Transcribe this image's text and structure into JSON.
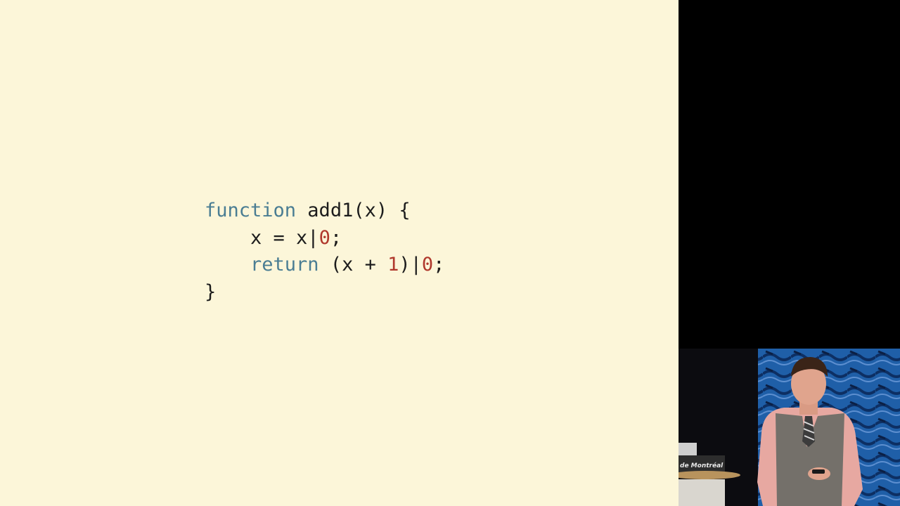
{
  "slide": {
    "background": "#fcf6d9",
    "code_lines": [
      [
        {
          "t": "function",
          "c": "kw"
        },
        {
          "t": " add1(x) {",
          "c": "txt"
        }
      ],
      [
        {
          "t": "    x = x|",
          "c": "txt"
        },
        {
          "t": "0",
          "c": "num"
        },
        {
          "t": ";",
          "c": "txt"
        }
      ],
      [
        {
          "t": "    ",
          "c": "txt"
        },
        {
          "t": "return",
          "c": "kw"
        },
        {
          "t": " (x + ",
          "c": "txt"
        },
        {
          "t": "1",
          "c": "num"
        },
        {
          "t": ")|",
          "c": "txt"
        },
        {
          "t": "0",
          "c": "num"
        },
        {
          "t": ";",
          "c": "txt"
        }
      ],
      [
        {
          "t": "}",
          "c": "txt"
        }
      ]
    ]
  },
  "colors": {
    "keyword": "#4a7d93",
    "number": "#b0382c",
    "text": "#1c1c1c"
  },
  "speaker_video": {
    "podium_sign_text": "de Montréal",
    "icon": "speaker-video-feed"
  }
}
